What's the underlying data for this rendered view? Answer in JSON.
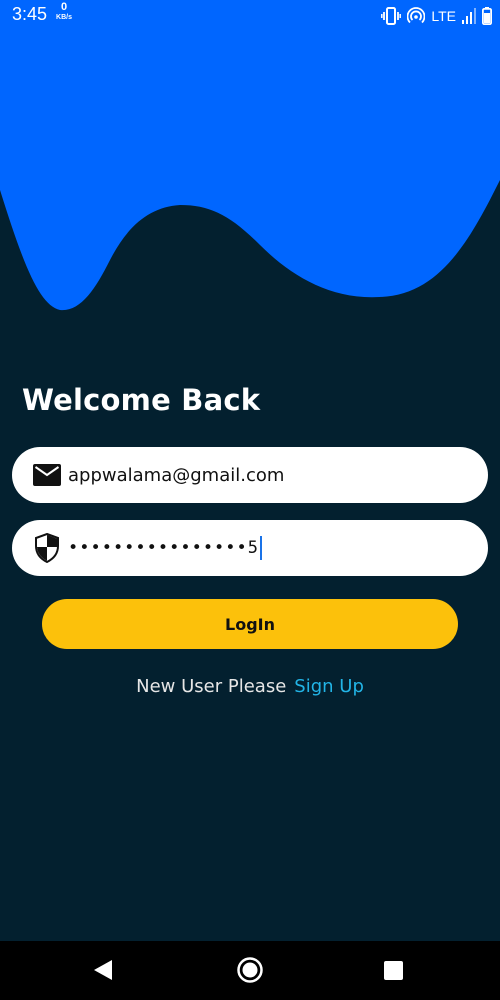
{
  "status_bar": {
    "time": "3:45",
    "speed_value": "0",
    "speed_unit": "KB/s",
    "network": "LTE",
    "icons": [
      "vibrate-icon",
      "hotspot-icon",
      "signal-icon",
      "battery-icon"
    ]
  },
  "colors": {
    "background": "#03202f",
    "wave": "#0066ff",
    "button": "#fcc10b",
    "link": "#22b4e6"
  },
  "login": {
    "title": "Welcome Back",
    "email": {
      "icon": "mail-icon",
      "value": "appwalama@gmail.com"
    },
    "password": {
      "icon": "shield-icon",
      "value": "••••••••••••••••5"
    },
    "login_label": "LogIn",
    "signup_prompt": "New User Please",
    "signup_link": "Sign Up"
  },
  "nav_bar": {
    "icons": [
      "back-icon",
      "home-icon",
      "recents-icon"
    ]
  }
}
